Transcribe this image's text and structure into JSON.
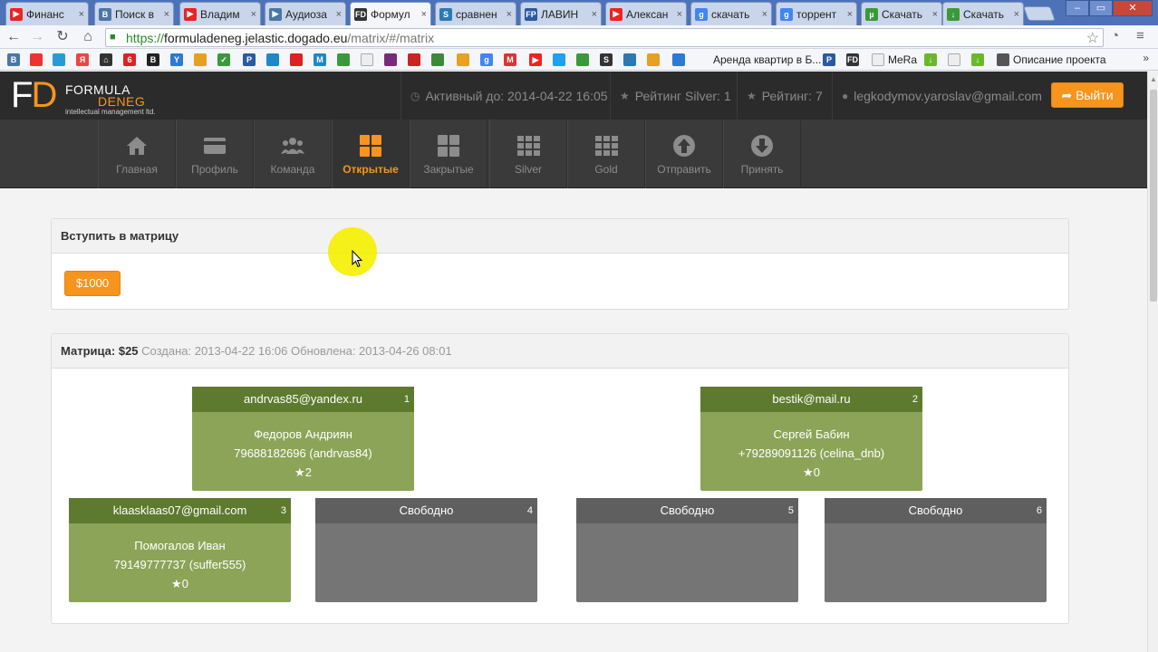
{
  "browser": {
    "tabs": [
      {
        "title": "Финанс",
        "fav": "yt",
        "color": "#e22"
      },
      {
        "title": "Поиск в",
        "fav": "vk",
        "color": "#4a76a8"
      },
      {
        "title": "Владим",
        "fav": "yt",
        "color": "#e22"
      },
      {
        "title": "Аудиоза",
        "fav": "play",
        "color": "#4a76a8"
      },
      {
        "title": "Формул",
        "fav": "FD",
        "color": "#333"
      },
      {
        "title": "сравнен",
        "fav": "S",
        "color": "#2a7ab5"
      },
      {
        "title": "ЛАВИН",
        "fav": "FP",
        "color": "#2a5aa0"
      },
      {
        "title": "Алексан",
        "fav": "yt",
        "color": "#e22"
      },
      {
        "title": "скачать",
        "fav": "g",
        "color": "#4285f4"
      },
      {
        "title": "торрент",
        "fav": "g",
        "color": "#4285f4"
      },
      {
        "title": "Скачать",
        "fav": "ut",
        "color": "#3a9a3a"
      },
      {
        "title": "Скачать",
        "fav": "dl",
        "color": "#3a9a3a"
      }
    ],
    "url_scheme": "https://",
    "url_host": "formuladeneg.jelastic.dogado.eu",
    "url_path": "/matrix/#/matrix",
    "bookmarks": {
      "label_1": "Аренда квартир в Б...",
      "label_2": "MeRa",
      "label_3": "Описание проекта"
    }
  },
  "header": {
    "logo_main": "FD",
    "logo_word_1": "FORMULA",
    "logo_word_2": "DENEG",
    "logo_tagline": "intellectual management ltd.",
    "active_until": "Активный до: 2014-04-22 16:05",
    "rating_silver": "Рейтинг Silver: 1",
    "rating": "Рейтинг: 7",
    "email": "legkodymov.yaroslav@gmail.com",
    "logout": "Выйти"
  },
  "nav": [
    {
      "label": "Главная",
      "icon": "home-icon"
    },
    {
      "label": "Профиль",
      "icon": "card-icon"
    },
    {
      "label": "Команда",
      "icon": "team-icon"
    },
    {
      "label": "Открытые",
      "icon": "grid-large-icon",
      "active": true
    },
    {
      "label": "Закрытые",
      "icon": "grid-large-icon"
    },
    {
      "label": "Silver",
      "icon": "grid-small-icon"
    },
    {
      "label": "Gold",
      "icon": "grid-small-icon"
    },
    {
      "label": "Отправить",
      "icon": "arrow-up-circle-icon"
    },
    {
      "label": "Принять",
      "icon": "arrow-down-circle-icon"
    }
  ],
  "join": {
    "title": "Вступить в матрицу",
    "button": "$1000"
  },
  "matrix": {
    "title": "Матрица: $25",
    "created": "Создана: 2013-04-22 16:06",
    "updated": "Обновлена: 2013-04-26 08:01",
    "cells": [
      {
        "num": "1",
        "email": "andrvas85@yandex.ru",
        "name": "Федоров Андриян",
        "contact": "79688182696 (andrvas84)",
        "rating": "2"
      },
      {
        "num": "2",
        "email": "bestik@mail.ru",
        "name": "Сергей Бабин",
        "contact": "+79289091126 (celina_dnb)",
        "rating": "0"
      },
      {
        "num": "3",
        "email": "klaasklaas07@gmail.com",
        "name": "Помогалов Иван",
        "contact": "79149777737 (suffer555)",
        "rating": "0"
      },
      {
        "num": "4",
        "email": "Свободно"
      },
      {
        "num": "5",
        "email": "Свободно"
      },
      {
        "num": "6",
        "email": "Свободно"
      }
    ]
  },
  "colors": {
    "accent": "#f7941d",
    "taken_header": "#5e7a2e",
    "taken_body": "#8ca457",
    "free_header": "#5f5f5f",
    "free_body": "#757575"
  }
}
